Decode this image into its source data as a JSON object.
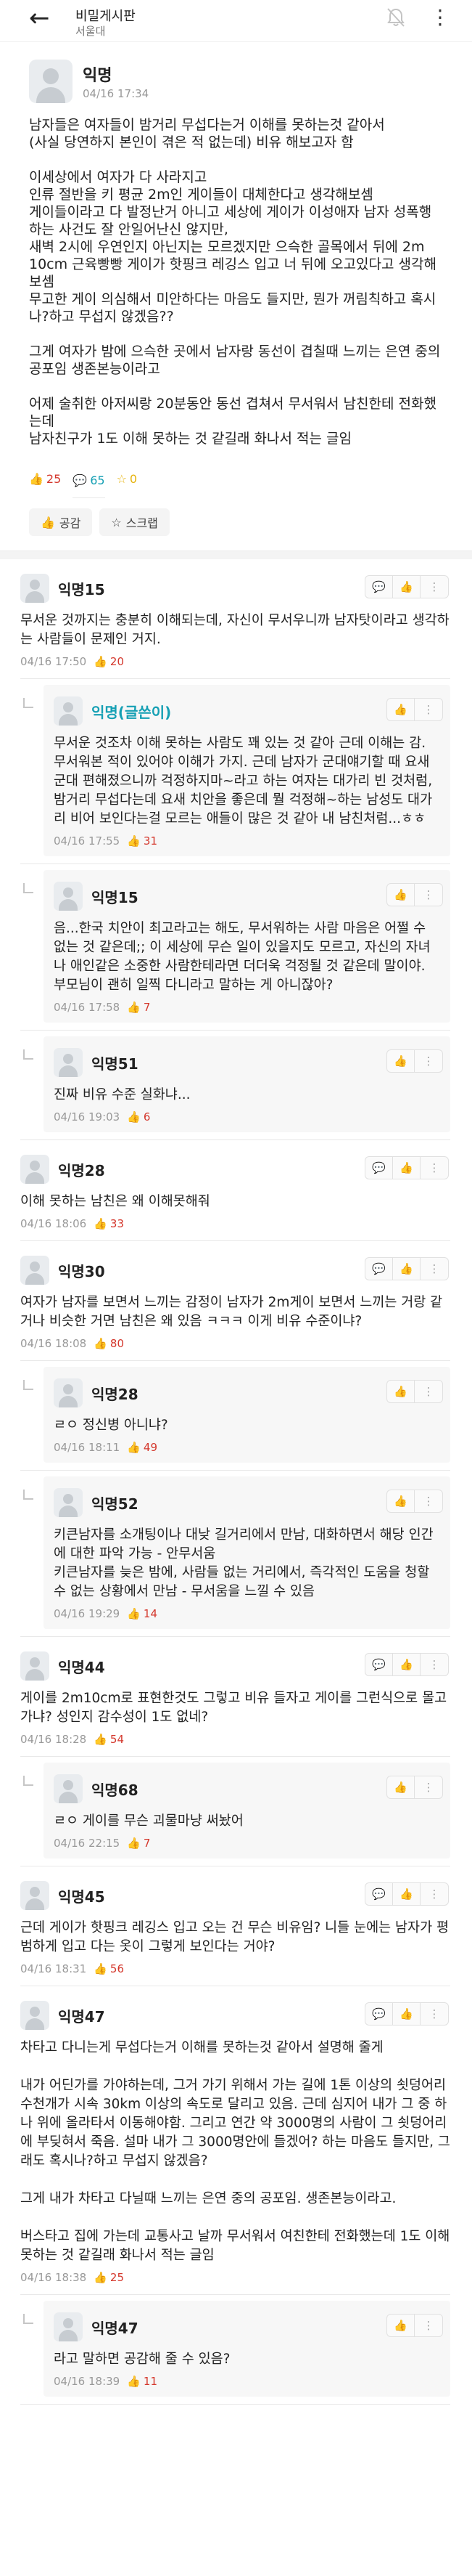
{
  "header": {
    "board_title": "비밀게시판",
    "school": "서울대",
    "back_icon": "back-arrow-icon",
    "bell_icon": "bell-icon",
    "more_icon": "more-vertical-icon"
  },
  "post": {
    "author": "익명",
    "time": "04/16 17:34",
    "body": "남자들은 여자들이 밤거리 무섭다는거 이해를 못하는것 같아서\n(사실 당연하지 본인이 겪은 적 없는데) 비유 해보고자 함\n\n이세상에서 여자가 다 사라지고\n인류 절반을 키 평균 2m인 게이들이 대체한다고 생각해보셈\n게이들이라고 다 발정난거 아니고 세상에 게이가 이성애자 남자 성폭행하는 사건도 잘 안일어난신 않지만,\n새벽 2시에 우연인지 아닌지는 모르겠지만 으슥한 골목에서 뒤에 2m 10cm 근육빵빵 게이가 핫핑크 레깅스 입고 너 뒤에 오고있다고 생각해보셈\n무고한 게이 의심해서 미안하다는 마음도 들지만, 뭔가 꺼림칙하고 혹시나?하고 무섭지 않겠음??\n\n그게 여자가 밤에 으슥한 곳에서 남자랑 동선이 겹칠때 느끼는 은연 중의 공포임 생존본능이라고\n\n어제 술취한 아저씨랑 20분동안 동선 겹쳐서 무서워서 남친한테 전화했는데\n남자친구가 1도 이해 못하는 것 같길래 화나서 적는 글임",
    "likes": "25",
    "comments": "65",
    "scraps": "0",
    "like_button": "공감",
    "scrap_button": "스크랩"
  },
  "comments": [
    {
      "author": "익명15",
      "writer": false,
      "reply": false,
      "body": "무서운 것까지는 충분히 이해되는데, 자신이 무서우니까 남자탓이라고 생각하는 사람들이 문제인 거지.",
      "time": "04/16 17:50",
      "likes": "20"
    },
    {
      "author": "익명(글쓴이)",
      "writer": true,
      "reply": true,
      "body": "무서운 것조차 이해 못하는 사람도 꽤 있는 것 같아 근데 이해는 감. 무서워본 적이 있어야 이해가 가지. 근데 남자가 군대얘기할 때 요새 군대 편해졌으니까 걱정하지마~라고 하는 여자는 대가리 빈 것처럼, 밤거리 무섭다는데 요새 치안을 좋은데 뭘 걱정해~하는 남성도 대가리 비어 보인다는걸 모르는 애들이 많은 것 같아 내 남친처럼...ㅎㅎ",
      "time": "04/16 17:55",
      "likes": "31"
    },
    {
      "author": "익명15",
      "writer": false,
      "reply": true,
      "body": "음...한국 치안이 최고라고는 해도, 무서워하는 사람 마음은 어쩔 수 없는 것 같은데;; 이 세상에 무슨 일이 있을지도 모르고, 자신의 자녀나 애인같은 소중한 사람한테라면 더더욱 걱정될 것 같은데 말이야. 부모님이 괜히 일찍 다니라고 말하는 게 아니잖아?",
      "time": "04/16 17:58",
      "likes": "7"
    },
    {
      "author": "익명51",
      "writer": false,
      "reply": true,
      "body": "진짜 비유 수준 실화냐...",
      "time": "04/16 19:03",
      "likes": "6"
    },
    {
      "author": "익명28",
      "writer": false,
      "reply": false,
      "body": "이해 못하는 남친은 왜 이해못해줘",
      "time": "04/16 18:06",
      "likes": "33"
    },
    {
      "author": "익명30",
      "writer": false,
      "reply": false,
      "body": "여자가 남자를 보면서 느끼는 감정이 남자가 2m게이 보면서 느끼는 거랑 같거나 비슷한 거면 남친은 왜 있음 ㅋㅋㅋ 이게 비유 수준이냐?",
      "time": "04/16 18:08",
      "likes": "80"
    },
    {
      "author": "익명28",
      "writer": false,
      "reply": true,
      "body": "ㄹㅇ 정신병 아니냐?",
      "time": "04/16 18:11",
      "likes": "49"
    },
    {
      "author": "익명52",
      "writer": false,
      "reply": true,
      "body": "키큰남자를 소개팅이나 대낮 길거리에서 만남, 대화하면서 해당 인간에 대한 파악 가능 - 안무서움\n키큰남자를 늦은 밤에, 사람들 없는 거리에서, 즉각적인 도움을 청할 수 없는 상황에서 만남 - 무서움을 느낄 수 있음",
      "time": "04/16 19:29",
      "likes": "14"
    },
    {
      "author": "익명44",
      "writer": false,
      "reply": false,
      "body": "게이를 2m10cm로 표현한것도 그렇고 비유 들자고 게이를 그런식으로 몰고가냐? 성인지 감수성이 1도 없네?",
      "time": "04/16 18:28",
      "likes": "54"
    },
    {
      "author": "익명68",
      "writer": false,
      "reply": true,
      "body": "ㄹㅇ 게이를 무슨 괴물마냥 써놨어",
      "time": "04/16 22:15",
      "likes": "7"
    },
    {
      "author": "익명45",
      "writer": false,
      "reply": false,
      "body": "근데 게이가 핫핑크 레깅스 입고 오는 건 무슨 비유임? 니들 눈에는 남자가 평범하게 입고 다는 옷이 그렇게 보인다는 거야?",
      "time": "04/16 18:31",
      "likes": "56"
    },
    {
      "author": "익명47",
      "writer": false,
      "reply": false,
      "body": "차타고 다니는게 무섭다는거 이해를 못하는것 같아서 설명해 줄게\n\n내가 어딘가를 가야하는데, 그거 가기 위해서 가는 길에 1톤 이상의 쇳덩어리 수천개가 시속 30km 이상의 속도로 달리고 있음. 근데 심지어 내가 그 중 하나 위에 올라타서 이동해야함. 그리고 연간 약 3000명의 사람이 그 쇳덩어리에 부딪혀서 죽음. 설마 내가 그 3000명안에 들겠어? 하는 마음도 들지만, 그래도 혹시나?하고 무섭지 않겠음?\n\n그게 내가 차타고 다닐때 느끼는 은연 중의 공포임. 생존본능이라고.\n\n버스타고 집에 가는데 교통사고 날까 무서워서 여친한테 전화했는데 1도 이해 못하는 것 같길래 화나서 적는 글임",
      "time": "04/16 18:38",
      "likes": "25"
    },
    {
      "author": "익명47",
      "writer": false,
      "reply": true,
      "body": "라고 말하면 공감해 줄 수 있음?",
      "time": "04/16 18:39",
      "likes": "11"
    }
  ],
  "comment_tools": {
    "comment_icon": "comment-icon",
    "like_icon": "thumbs-up-icon",
    "more_icon": "more-vertical-icon"
  }
}
